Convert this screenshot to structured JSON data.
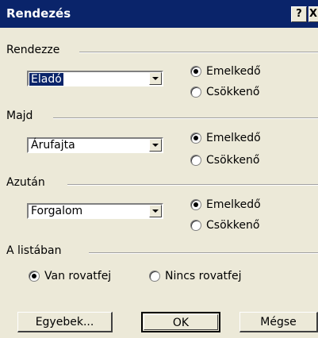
{
  "window": {
    "title": "Rendezés",
    "help_label": "?",
    "close_label": "X"
  },
  "groups": [
    {
      "title": "Rendezze",
      "combo_value": "Eladó",
      "radio_1": "Emelkedő",
      "radio_2": "Csökkenő",
      "selected": "radio_1"
    },
    {
      "title": "Majd",
      "combo_value": "Árufajta",
      "radio_1": "Emelkedő",
      "radio_2": "Csökkenő",
      "selected": "radio_1"
    },
    {
      "title": "Azután",
      "combo_value": "Forgalom",
      "radio_1": "Emelkedő",
      "radio_2": "Csökkenő",
      "selected": "radio_1"
    }
  ],
  "header_group": {
    "title": "A listában",
    "radio_1": "Van rovatfej",
    "radio_2": "Nincs rovatfej",
    "selected": "radio_1"
  },
  "buttons": {
    "options": "Egyebek...",
    "ok": "OK",
    "cancel": "Mégse"
  }
}
